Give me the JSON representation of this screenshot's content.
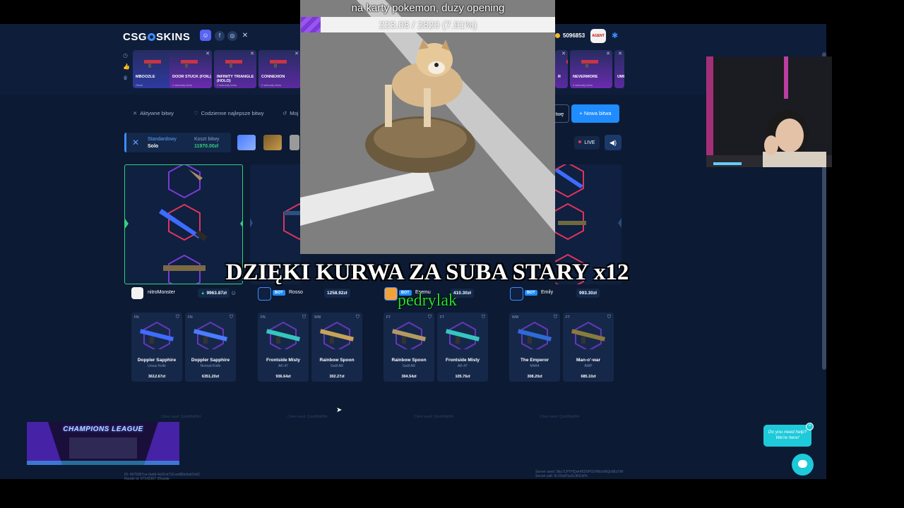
{
  "site": {
    "logo": {
      "left": "CSG",
      "right": "SKINS"
    },
    "social": [
      "discord-icon",
      "facebook-icon",
      "instagram-icon",
      "x-icon"
    ],
    "balance": "5096853",
    "avatar_text": "AGENT",
    "live_drops": [
      {
        "name": "MBOOZLE",
        "sub": "Glock",
        "color": "#2e3aa0"
      },
      {
        "name": "DOOR STUCK (FOIL)",
        "sub": "2 sekundy temu",
        "color": "#6b2bb0"
      },
      {
        "name": "INFINITY TRIANGLE (HOLO)",
        "sub": "2 sekundy temu",
        "color": "#5b2aa0"
      },
      {
        "name": "CONNEXION",
        "sub": "2 sekundy temu",
        "color": "#5b2aa0"
      },
      {
        "name": "R",
        "sub": "",
        "color": "#5b2aa0"
      },
      {
        "name": "NEVERMORE",
        "sub": "2 sekundy temu",
        "color": "#6b2bb0"
      },
      {
        "name": "UMI",
        "sub": "",
        "color": "#5b2aa0"
      }
    ],
    "nav": {
      "active_battles": "Aktywne bitwy",
      "daily_best": "Codzienne najlepsze bitwy",
      "my": "Moj",
      "create_partial": "twę",
      "new_battle": "+ Nowa bitwa"
    },
    "battle": {
      "mode": "Standardowy",
      "type": "Solo",
      "cost_label": "Koszt bitwy",
      "cost": "11970.00zł",
      "live": "LIVE"
    },
    "players": [
      {
        "name": "nitroMonster",
        "bot": false,
        "value": "9963.87zł",
        "up": true
      },
      {
        "name": "Rosso",
        "bot": true,
        "value": "1258.92zł",
        "up": false
      },
      {
        "name": "Esemu",
        "bot": true,
        "value": "410.30zł",
        "up": false
      },
      {
        "name": "Emily",
        "bot": true,
        "value": "993.30zł",
        "up": false
      }
    ],
    "bot_tag": "BOT",
    "items": [
      {
        "cond": "FN",
        "name": "Doppler Sapphire",
        "sub": "Ursus Knife",
        "price": "3612.67zł",
        "color": "#3f6cff"
      },
      {
        "cond": "FN",
        "name": "Doppler Sapphire",
        "sub": "Nomad Knife",
        "price": "6351.20zł",
        "color": "#4a7dff"
      },
      {
        "cond": "FN",
        "name": "Frontside Misty",
        "sub": "AK-47",
        "price": "936.64zł",
        "color": "#35c6c0"
      },
      {
        "cond": "WW",
        "name": "Rainbow Spoon",
        "sub": "Galil AR",
        "price": "302.27zł",
        "color": "#c7a35a"
      },
      {
        "cond": "FT",
        "name": "Rainbow Spoon",
        "sub": "Galil AR",
        "price": "304.54zł",
        "color": "#b49a62"
      },
      {
        "cond": "FT",
        "name": "Frontside Misty",
        "sub": "AK-47",
        "price": "105.76zł",
        "color": "#35c6c0"
      },
      {
        "cond": "WW",
        "name": "The Emperor",
        "sub": "M4A4",
        "price": "308.20zł",
        "color": "#2e6bd6"
      },
      {
        "cond": "FT",
        "name": "Man-o'-war",
        "sub": "AWP",
        "price": "685.10zł",
        "color": "#8b7a3d"
      }
    ],
    "client_seed_label": "Client seed: Qxkk9flqRft4",
    "footer_left": [
      "ID: 4975957ce-0eb9-4c59-b716-eef80c6eb7e62",
      "Runde id: 07142307 2Runde"
    ],
    "footer_right": [
      "Server seed: 9bu7LPYHQvk45SVPGVHEchNQv9EsTtH",
      "Secret salt: 5LVUwPysZL9hCeFk"
    ],
    "help": {
      "line1": "Do you need help?",
      "line2": "We're here!",
      "close": "×"
    }
  },
  "stream": {
    "goal_title": "na karty pokemon, duży opening",
    "goal_text": "223.08 / 2820 (7.91%)",
    "goal_progress": 0.0791,
    "sub_alert": "DZIĘKI KURWA ZA SUBA STARY x12",
    "sub_name": "pedrylak",
    "banner_title": "CHAMPIONS LEAGUE"
  }
}
